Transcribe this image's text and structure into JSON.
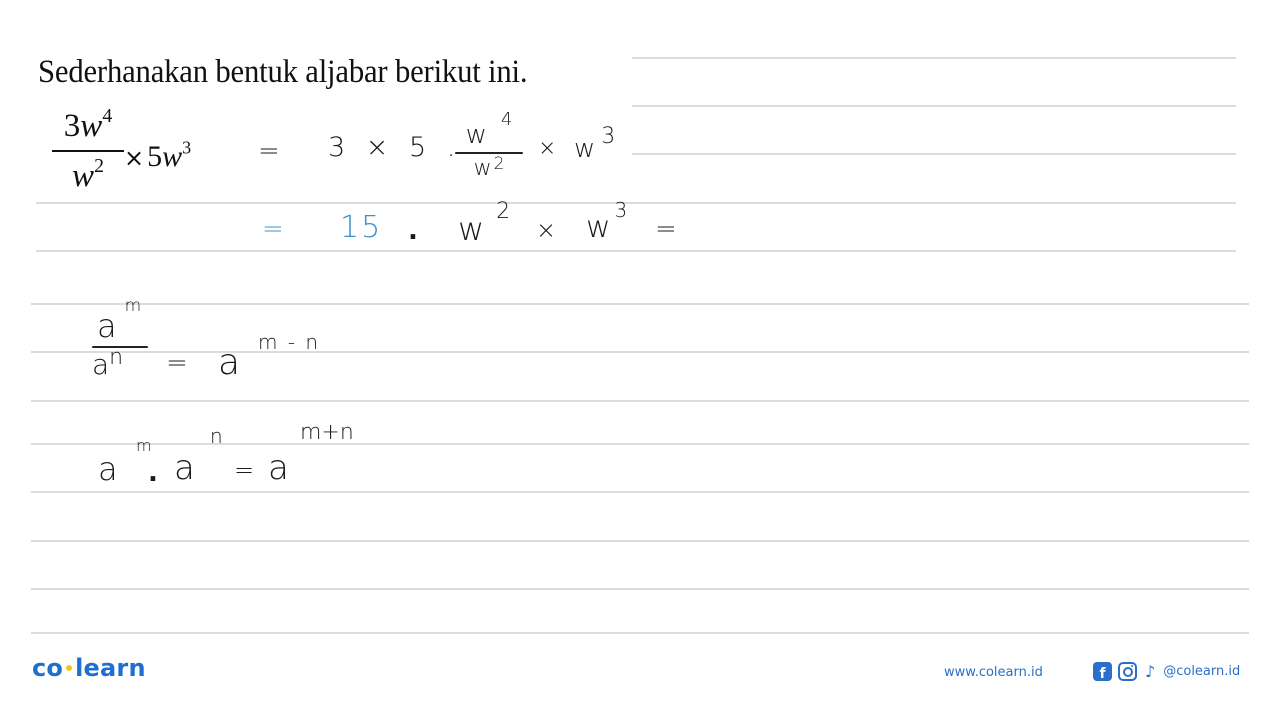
{
  "question": "Sederhanakan bentuk aljabar berikut ini.",
  "problem": {
    "numerator_coef": "3",
    "numerator_var": "w",
    "numerator_exp": "4",
    "denominator_var": "w",
    "denominator_exp": "2",
    "times": "×",
    "factor_coef": "5",
    "factor_var": "w",
    "factor_exp": "3"
  },
  "handwritten": {
    "step1": {
      "eq": "=",
      "coeffs": "3 × 5 .",
      "num": "w",
      "num_exp": "4",
      "den": "w",
      "den_exp": "2",
      "times": "×",
      "var": "w",
      "var_exp": "3"
    },
    "step2": {
      "eq": "=",
      "coef": "15",
      "dot": ".",
      "var1": "w",
      "exp1": "2",
      "times": "×",
      "var2": "w",
      "exp2": "3",
      "eq_end": "="
    },
    "rule_division": {
      "num": "a",
      "num_exp": "m",
      "den": "a",
      "den_exp": "n",
      "eq": "=",
      "result": "a",
      "result_exp": "m - n"
    },
    "rule_product": {
      "base1": "a",
      "exp1": "m",
      "dot": ".",
      "base2": "a",
      "exp2": "n",
      "eq": "=",
      "result": "a",
      "result_exp": "m+n"
    }
  },
  "colors": {
    "ink": "#1a1a1a",
    "blue_ink": "#3a8fcf",
    "brand": "#1f6fd1",
    "brand_dot": "#f5c518",
    "rule_line": "#dcdcdc"
  },
  "footer": {
    "logo_left": "co",
    "logo_right": "learn",
    "website": "www.colearn.id",
    "social_icons": [
      "facebook-icon",
      "instagram-icon",
      "tiktok-icon"
    ],
    "facebook_glyph": "f",
    "tiktok_glyph": "♪",
    "handle": "@colearn.id"
  }
}
